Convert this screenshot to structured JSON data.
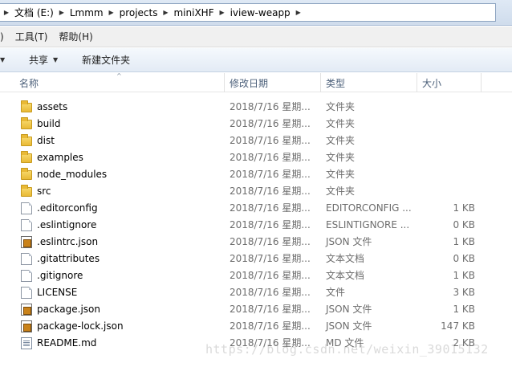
{
  "address_bar": {
    "crumbs": [
      "文档 (E:)",
      "Lmmm",
      "projects",
      "miniXHF",
      "iview-weapp"
    ]
  },
  "menu": {
    "partial": ")",
    "tools": "工具(T)",
    "help": "帮助(H)"
  },
  "toolbar": {
    "share": "共享",
    "new_folder": "新建文件夹"
  },
  "columns": {
    "name": "名称",
    "modified": "修改日期",
    "type": "类型",
    "size": "大小"
  },
  "files": [
    {
      "name": "assets",
      "date": "2018/7/16 星期...",
      "type": "文件夹",
      "size": "",
      "icon": "folder"
    },
    {
      "name": "build",
      "date": "2018/7/16 星期...",
      "type": "文件夹",
      "size": "",
      "icon": "folder"
    },
    {
      "name": "dist",
      "date": "2018/7/16 星期...",
      "type": "文件夹",
      "size": "",
      "icon": "folder"
    },
    {
      "name": "examples",
      "date": "2018/7/16 星期...",
      "type": "文件夹",
      "size": "",
      "icon": "folder"
    },
    {
      "name": "node_modules",
      "date": "2018/7/16 星期...",
      "type": "文件夹",
      "size": "",
      "icon": "folder"
    },
    {
      "name": "src",
      "date": "2018/7/16 星期...",
      "type": "文件夹",
      "size": "",
      "icon": "folder"
    },
    {
      "name": ".editorconfig",
      "date": "2018/7/16 星期...",
      "type": "EDITORCONFIG ...",
      "size": "1 KB",
      "icon": "file"
    },
    {
      "name": ".eslintignore",
      "date": "2018/7/16 星期...",
      "type": "ESLINTIGNORE ...",
      "size": "0 KB",
      "icon": "file"
    },
    {
      "name": ".eslintrc.json",
      "date": "2018/7/16 星期...",
      "type": "JSON 文件",
      "size": "1 KB",
      "icon": "json"
    },
    {
      "name": ".gitattributes",
      "date": "2018/7/16 星期...",
      "type": "文本文档",
      "size": "0 KB",
      "icon": "file"
    },
    {
      "name": ".gitignore",
      "date": "2018/7/16 星期...",
      "type": "文本文档",
      "size": "1 KB",
      "icon": "file"
    },
    {
      "name": "LICENSE",
      "date": "2018/7/16 星期...",
      "type": "文件",
      "size": "3 KB",
      "icon": "file"
    },
    {
      "name": "package.json",
      "date": "2018/7/16 星期...",
      "type": "JSON 文件",
      "size": "1 KB",
      "icon": "json"
    },
    {
      "name": "package-lock.json",
      "date": "2018/7/16 星期...",
      "type": "JSON 文件",
      "size": "147 KB",
      "icon": "json"
    },
    {
      "name": "README.md",
      "date": "2018/7/16 星期...",
      "type": "MD 文件",
      "size": "2 KB",
      "icon": "md"
    }
  ],
  "watermark": "https://blog.csdn.net/weixin_39015132"
}
